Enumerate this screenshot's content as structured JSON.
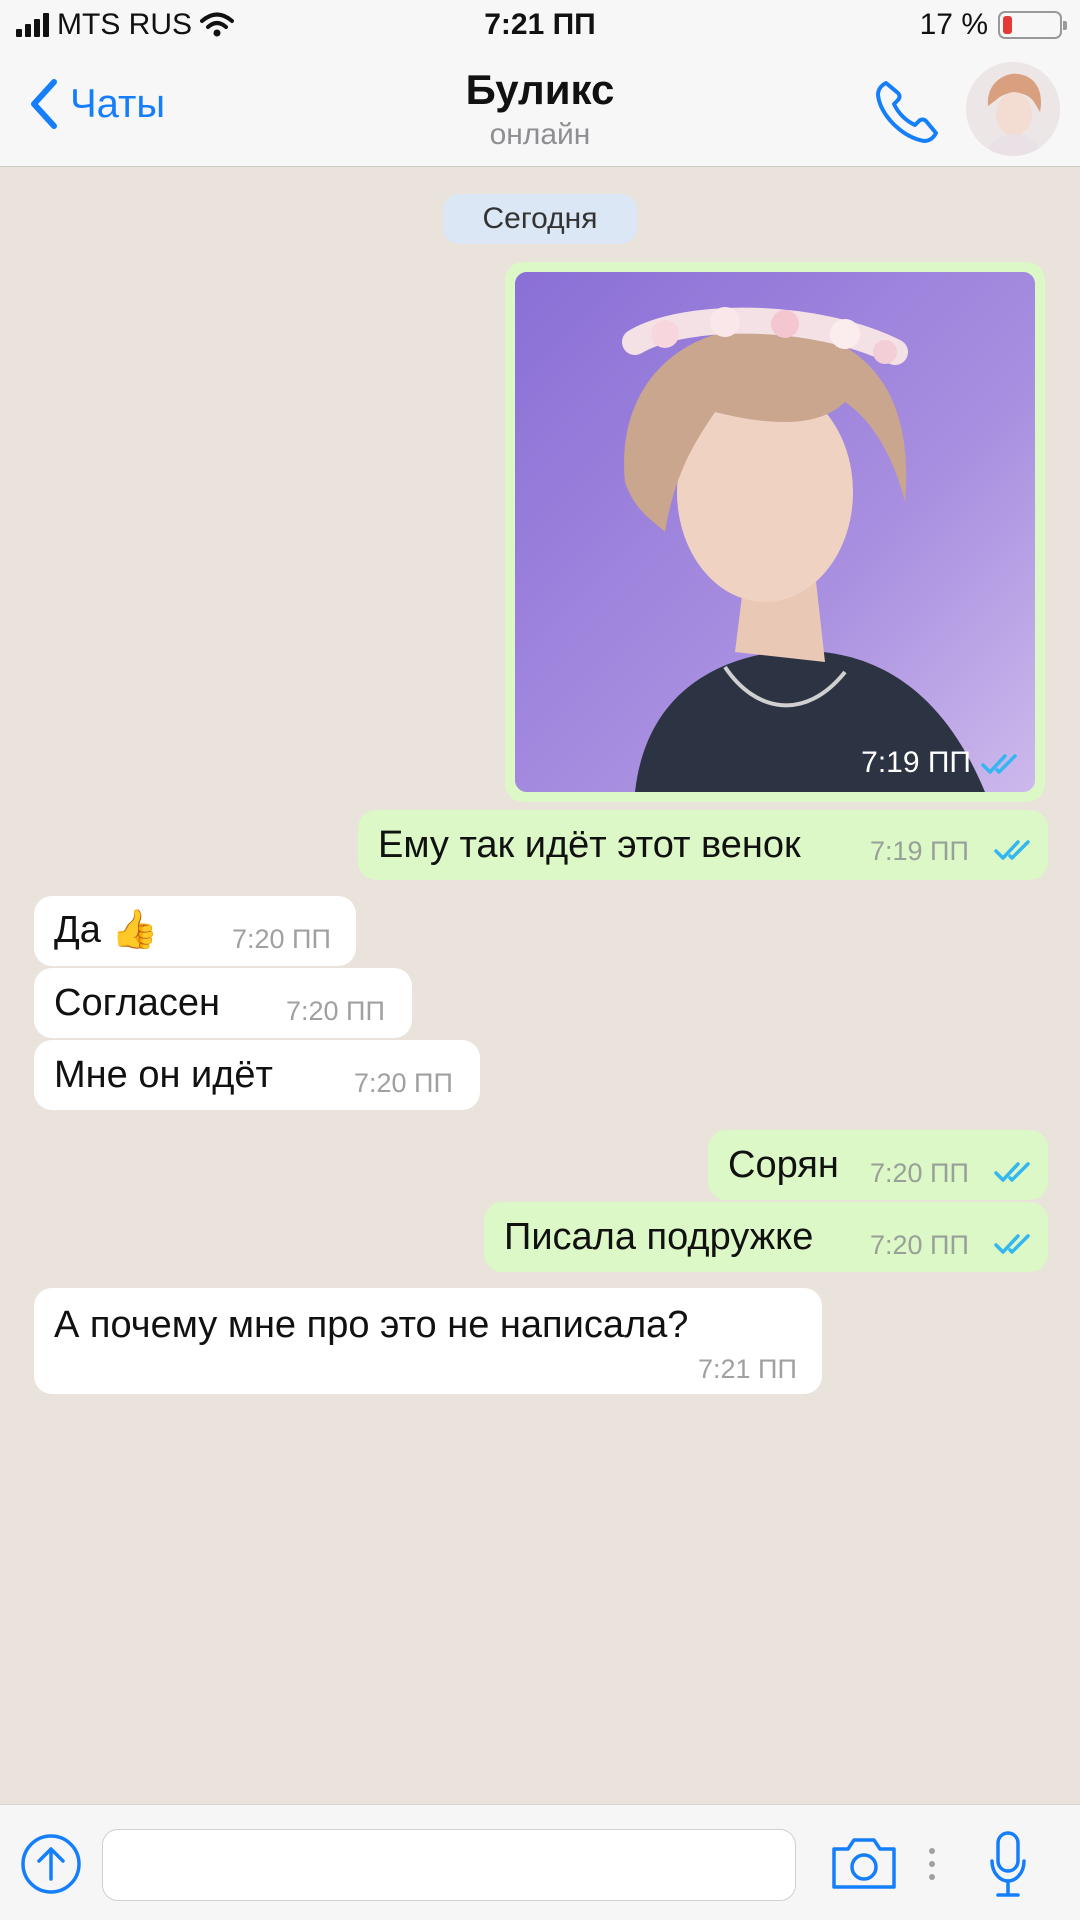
{
  "status_bar": {
    "carrier": "MTS RUS",
    "time": "7:21 ПП",
    "battery_percent": "17 %",
    "battery_level": 0.17
  },
  "header": {
    "back_label": "Чаты",
    "contact_name": "Буликс",
    "contact_status": "онлайн"
  },
  "chat": {
    "date_divider": "Сегодня",
    "messages": [
      {
        "direction": "out",
        "type": "photo",
        "time": "7:19 ПП",
        "read": true
      },
      {
        "direction": "out",
        "text": "Ему так идёт этот венок",
        "time": "7:19 ПП",
        "read": true
      },
      {
        "direction": "in",
        "text": "Да 👍",
        "time": "7:20 ПП"
      },
      {
        "direction": "in",
        "text": "Согласен",
        "time": "7:20 ПП"
      },
      {
        "direction": "in",
        "text": "Мне он идёт",
        "time": "7:20 ПП"
      },
      {
        "direction": "out",
        "text": "Сорян",
        "time": "7:20 ПП",
        "read": true
      },
      {
        "direction": "out",
        "text": "Писала подружке",
        "time": "7:20 ПП",
        "read": true
      },
      {
        "direction": "in",
        "text": "А почему мне про это не написала?",
        "time": "7:21 ПП"
      }
    ]
  },
  "colors": {
    "accent": "#157EFB",
    "outgoing_bubble": "#DCF8C6",
    "incoming_bubble": "#FFFFFF",
    "chat_background": "#E9E3DC",
    "read_ticks": "#34B7F1"
  },
  "icons": {
    "back": "chevron-left-icon",
    "call": "phone-icon",
    "upload": "arrow-up-circle-icon",
    "camera": "camera-icon",
    "mic": "microphone-icon"
  }
}
